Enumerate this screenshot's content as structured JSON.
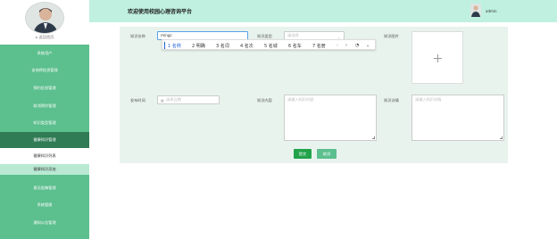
{
  "sidebar": {
    "back_home": "返回首页",
    "items": [
      {
        "label": "系统用户"
      },
      {
        "label": "咨询师信息管理"
      },
      {
        "label": "预约信息管理"
      },
      {
        "label": "取消预约管理"
      },
      {
        "label": "知识类型管理"
      },
      {
        "label": "健康知识管理",
        "state": "active"
      },
      {
        "label": "健康知识列表",
        "state": "sub"
      },
      {
        "label": "健康知识添加",
        "state": "sub-selected"
      },
      {
        "label": "意见投稿管理"
      },
      {
        "label": "系统管理"
      },
      {
        "label": "通知公告管理"
      }
    ]
  },
  "header": {
    "title": "欢迎使用校园心理咨询平台",
    "user_name": "admin"
  },
  "form": {
    "knowledge_name_label": "知识名称",
    "knowledge_name_value": "mingc",
    "knowledge_type_label": "知识类型",
    "knowledge_type_placeholder": "请选择",
    "knowledge_image_label": "知识图片",
    "publish_time_label": "发布时间",
    "publish_time_placeholder": "选择日期",
    "knowledge_content_label": "知识内容",
    "knowledge_content_placeholder": "请输入知识内容",
    "knowledge_detail_label": "知识详情",
    "knowledge_detail_placeholder": "请输入知识详情",
    "submit_label": "提交",
    "cancel_label": "取消"
  },
  "ime": {
    "candidates": [
      "1 名称",
      "2 明确",
      "3 名词",
      "4 名次",
      "5 名城",
      "6 名车",
      "7 名册"
    ],
    "controls": [
      "‹",
      "›",
      "◔",
      "⌄"
    ]
  },
  "colors": {
    "sidebar": "#5cbf8e",
    "sidebar_active": "#2f7c55",
    "header": "#bff0e0",
    "panel": "#e8f3ee",
    "submit": "#22a34a"
  }
}
